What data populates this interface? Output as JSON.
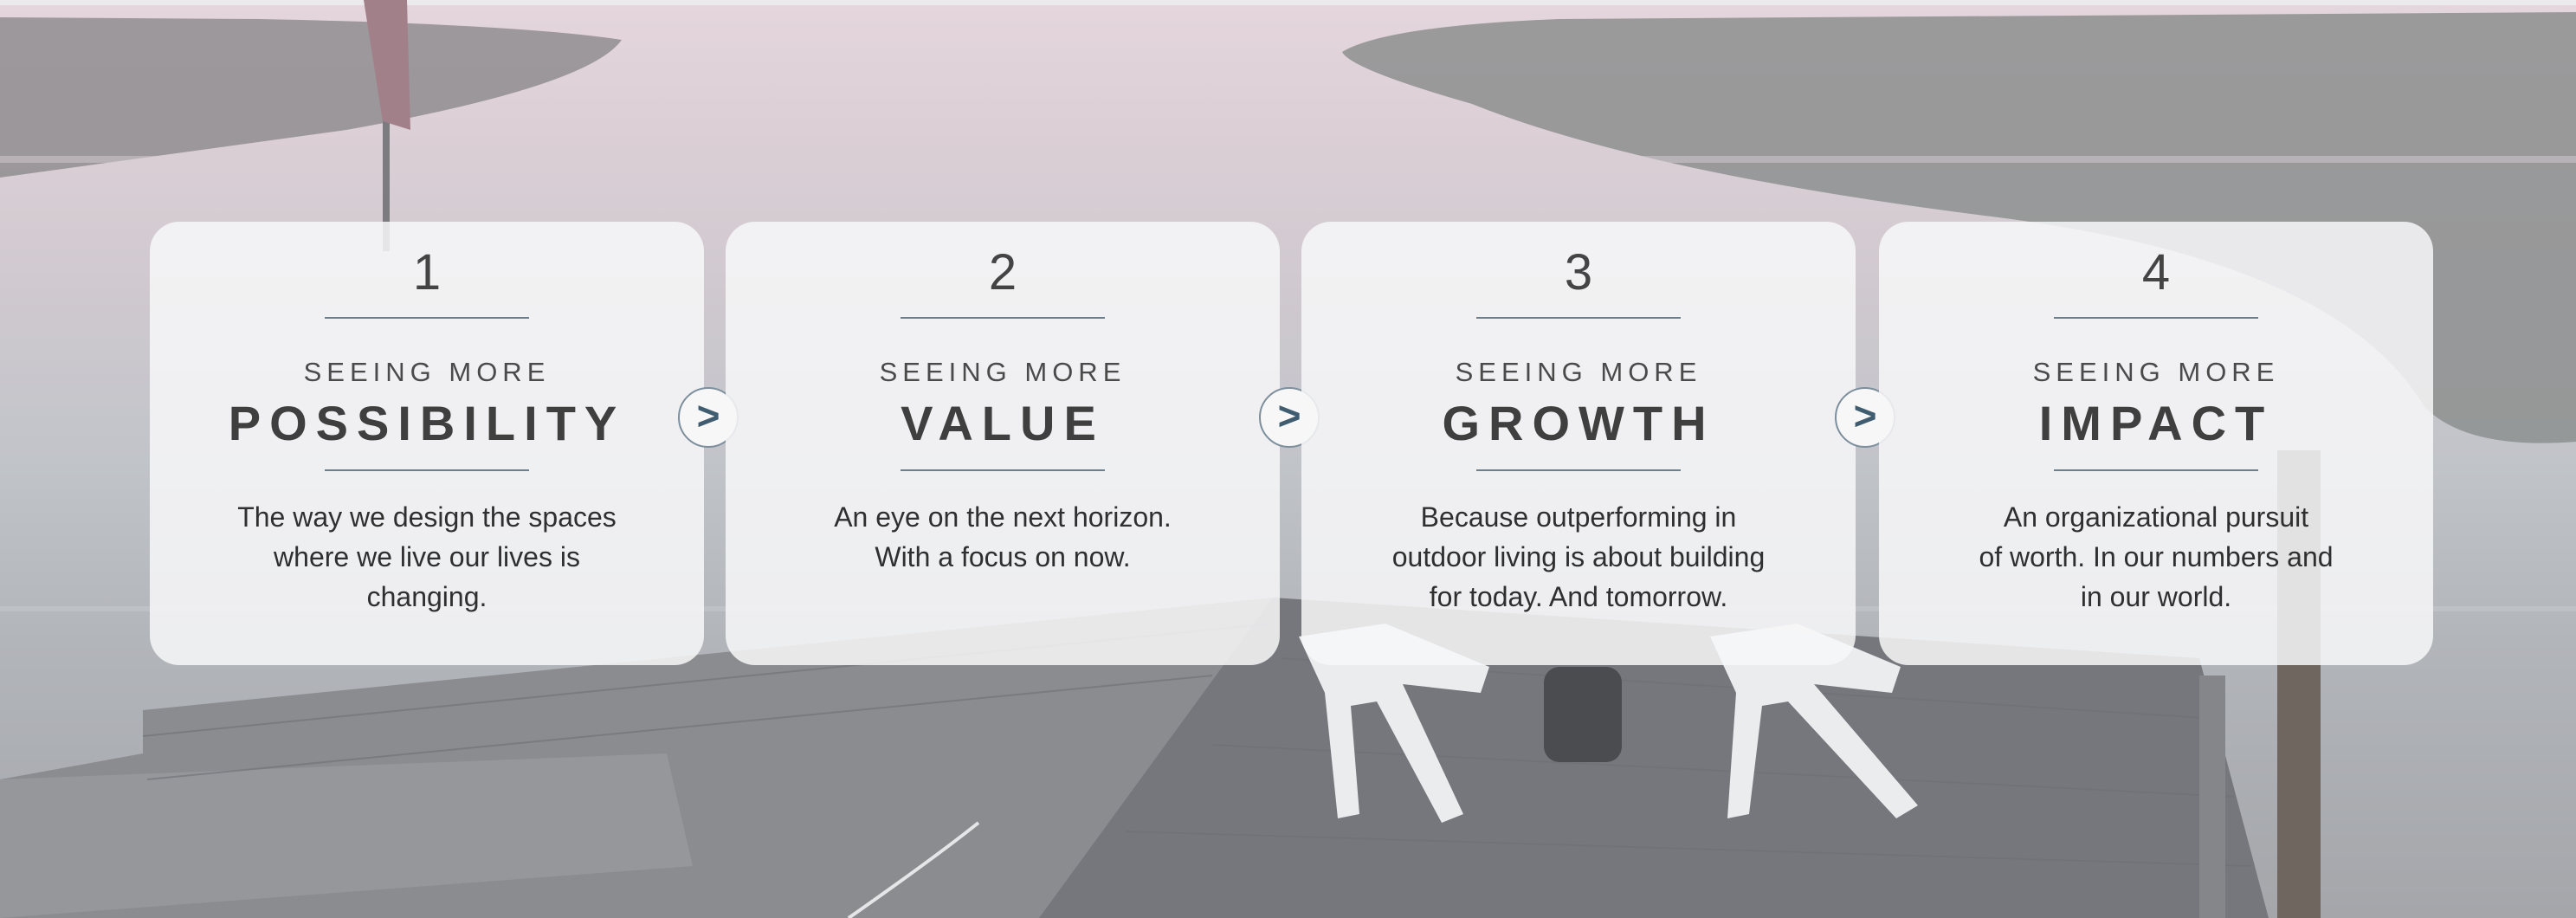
{
  "cards": [
    {
      "number": "1",
      "kicker": "SEEING MORE",
      "title": "POSSIBILITY",
      "description": "The way we design the spaces\nwhere we live our lives is\nchanging."
    },
    {
      "number": "2",
      "kicker": "SEEING MORE",
      "title": "VALUE",
      "description": "An eye on the next horizon.\nWith a focus on now."
    },
    {
      "number": "3",
      "kicker": "SEEING MORE",
      "title": "GROWTH",
      "description": "Because outperforming in\noutdoor living is about building\nfor today. And tomorrow."
    },
    {
      "number": "4",
      "kicker": "SEEING MORE",
      "title": "IMPACT",
      "description": "An organizational pursuit\nof worth. In our numbers and\nin our world."
    }
  ],
  "arrows": [
    {
      "glyph": ">",
      "icon": "chevron-right-icon"
    },
    {
      "glyph": ">",
      "icon": "chevron-right-icon"
    },
    {
      "glyph": ">",
      "icon": "chevron-right-icon"
    }
  ],
  "colors": {
    "card_background": "#f7f7f8",
    "rule": "#6a8090",
    "arrow_border": "#7d8f9c",
    "arrow_glyph": "#3f5c70",
    "title_text": "#3f3f3f"
  }
}
